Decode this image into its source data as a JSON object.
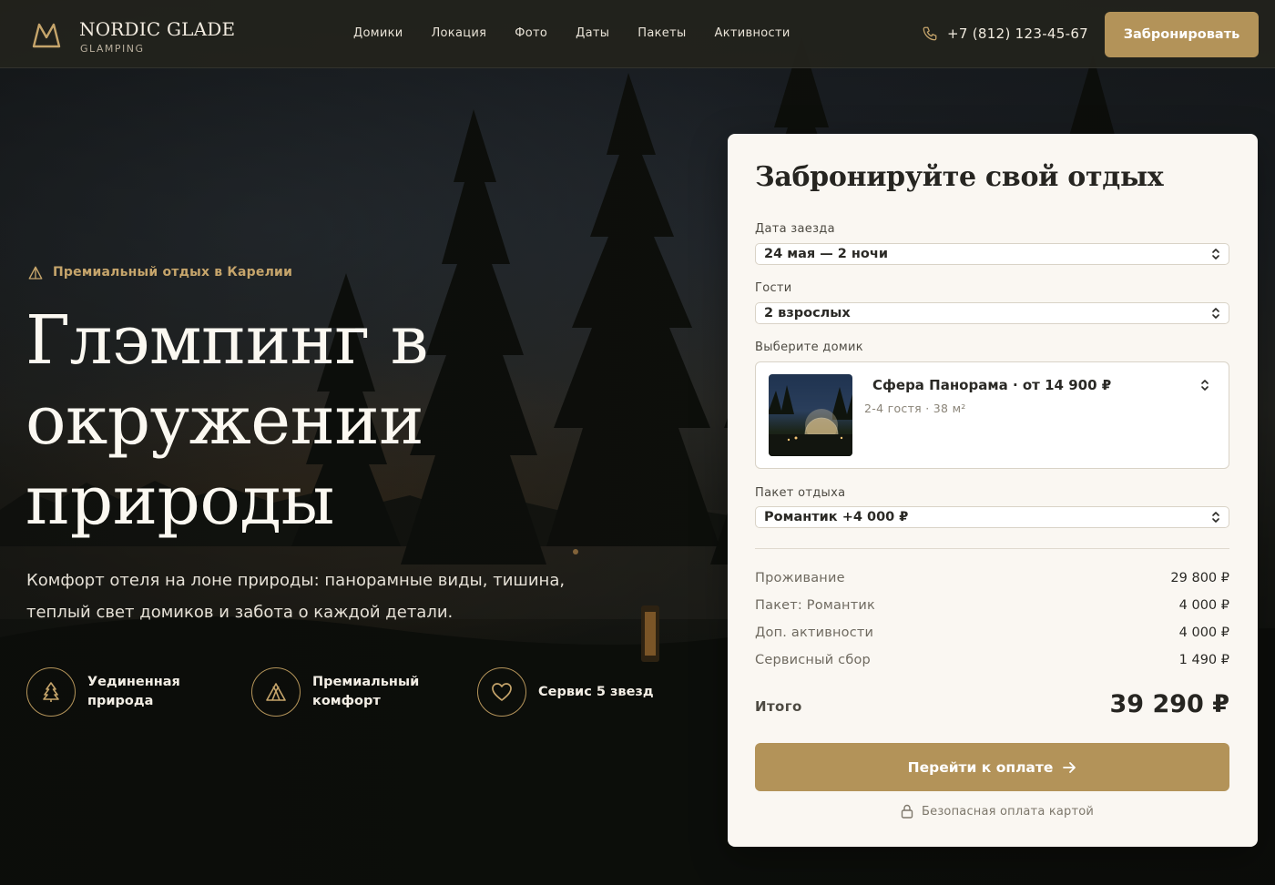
{
  "brand": {
    "name": "NORDIC GLADE",
    "subtitle": "GLAMPING"
  },
  "nav": [
    "Домики",
    "Локация",
    "Фото",
    "Даты",
    "Пакеты",
    "Активности"
  ],
  "header": {
    "phone": "+7 (812) 123-45-67",
    "book_label": "Забронировать"
  },
  "hero": {
    "eyebrow": "Премиальный отдых в Карелии",
    "title": "Глэмпинг в окружении природы",
    "text": "Комфорт отеля на лоне природы: панорамные виды, тишина, теплый свет домиков и забота о каждой детали.",
    "features": [
      {
        "label": "Уединенная природа",
        "icon": "tree-icon"
      },
      {
        "label": "Премиальный комфорт",
        "icon": "tent-icon"
      },
      {
        "label": "Сервис 5 звезд",
        "icon": "heart-icon"
      }
    ]
  },
  "booking": {
    "title": "Забронируйте свой отдых",
    "checkin": {
      "label": "Дата заезда",
      "value": "24 мая — 2 ночи"
    },
    "guests": {
      "label": "Гости",
      "value": "2 взрослых"
    },
    "cabin": {
      "label": "Выберите домик",
      "name": "Сфера Панорама · от 14 900 ₽",
      "meta": "2-4 гостя · 38 м²"
    },
    "package": {
      "label": "Пакет отдыха",
      "value": "Романтик +4 000 ₽"
    },
    "prices": [
      {
        "label": "Проживание",
        "value": "29 800 ₽"
      },
      {
        "label": "Пакет: Романтик",
        "value": "4 000 ₽"
      },
      {
        "label": "Доп. активности",
        "value": "4 000 ₽"
      },
      {
        "label": "Сервисный сбор",
        "value": "1 490 ₽"
      }
    ],
    "total": {
      "label": "Итого",
      "value": "39 290 ₽"
    },
    "pay_label": "Перейти к оплате",
    "secure_note": "Безопасная оплата картой"
  },
  "colors": {
    "accent": "#b39359",
    "accent_text": "#c6a56b",
    "card_bg": "#faf7f2",
    "header_bg": "#22221c"
  }
}
